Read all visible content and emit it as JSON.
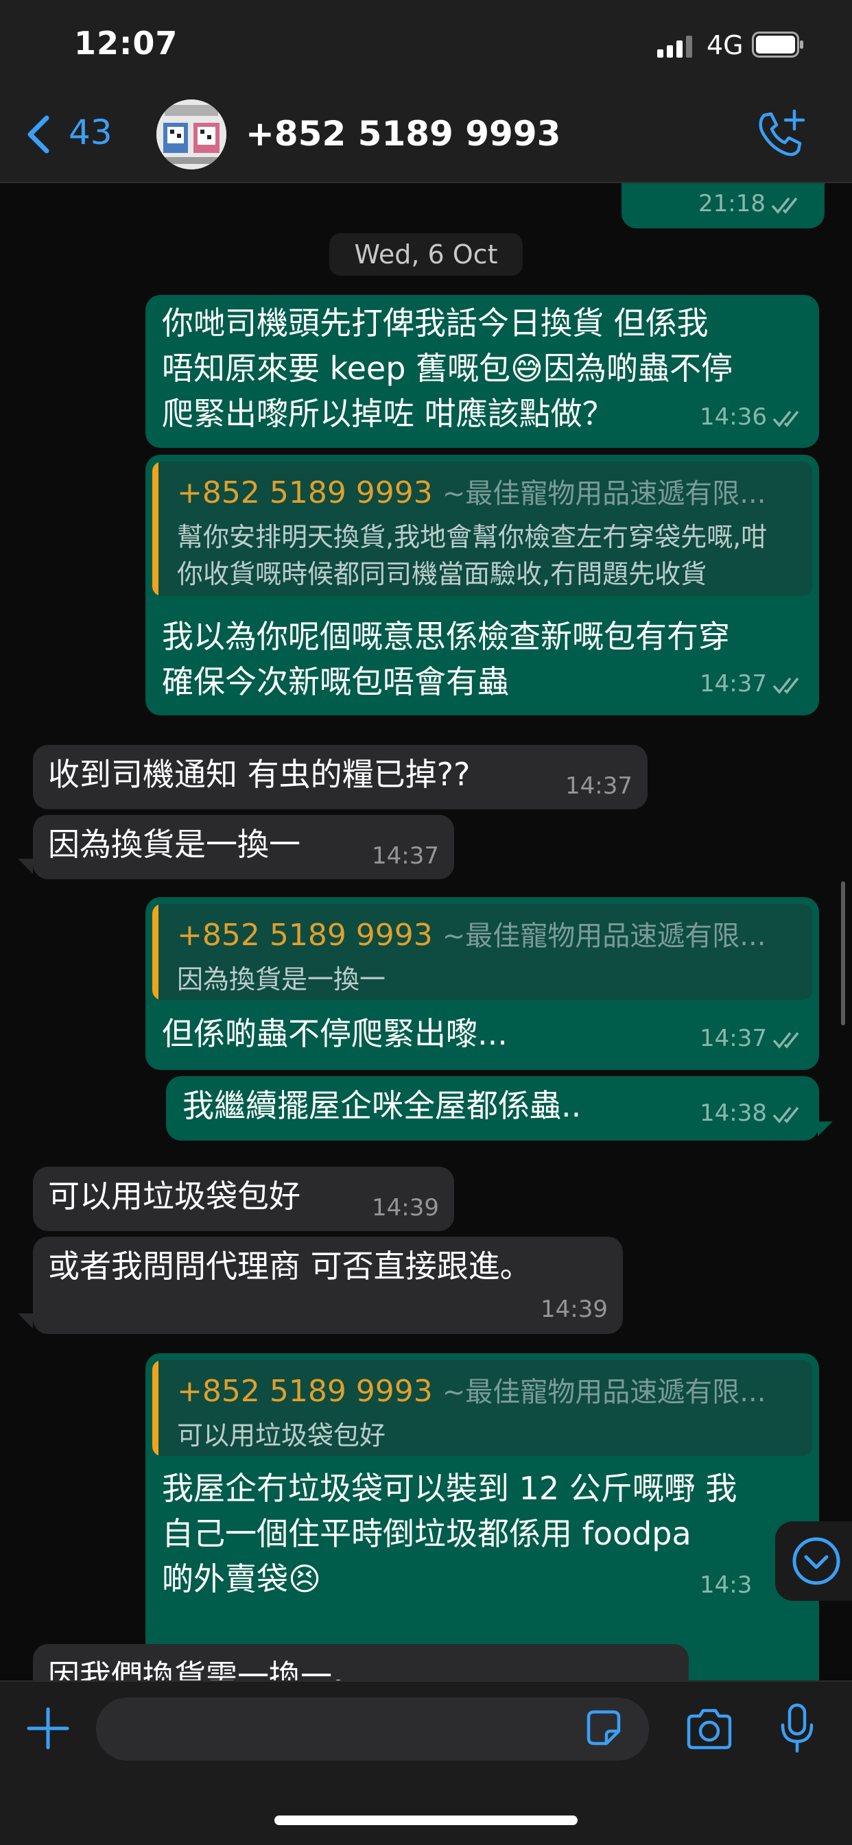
{
  "status_bar": {
    "time": "12:07",
    "network": "4G"
  },
  "header": {
    "back_count": "43",
    "contact_name": "+852 5189 9993"
  },
  "date_separator": "Wed, 6 Oct",
  "messages": [
    {
      "dir": "out",
      "time": "21:18",
      "partial": true
    },
    {
      "dir": "out",
      "lines": [
        "你哋司機頭先打俾我話今日換貨 但係我",
        "唔知原來要 keep 舊嘅包😅因為啲蟲不停",
        "爬緊出嚟所以掉咗 咁應該點做？"
      ],
      "time": "14:36"
    },
    {
      "dir": "out",
      "quote": {
        "number": "+852 5189 9993",
        "name": "~最佳寵物用品速遞有限...",
        "lines": [
          "幫你安排明天換貨,我地會幫你檢查左冇穿袋先嘅,咁",
          "你收貨嘅時候都同司機當面驗收,冇問題先收貨"
        ]
      },
      "lines": [
        "我以為你呢個嘅意思係檢查新嘅包有冇穿",
        "確保今次新嘅包唔會有蟲"
      ],
      "time": "14:37"
    },
    {
      "dir": "in",
      "lines": [
        "收到司機通知 有虫的糧已掉??"
      ],
      "time": "14:37"
    },
    {
      "dir": "in",
      "lines": [
        "因為換貨是一換一"
      ],
      "time": "14:37"
    },
    {
      "dir": "out",
      "quote": {
        "number": "+852 5189 9993",
        "name": "~最佳寵物用品速遞有限...",
        "lines": [
          "因為換貨是一換一"
        ]
      },
      "lines": [
        "但係啲蟲不停爬緊出嚟..."
      ],
      "time": "14:37"
    },
    {
      "dir": "out",
      "lines": [
        "我繼續擺屋企咪全屋都係蟲.."
      ],
      "time": "14:38"
    },
    {
      "dir": "in",
      "lines": [
        "可以用垃圾袋包好"
      ],
      "time": "14:39"
    },
    {
      "dir": "in",
      "lines": [
        "或者我問問代理商 可否直接跟進。"
      ],
      "time": "14:39"
    },
    {
      "dir": "out",
      "quote": {
        "number": "+852 5189 9993",
        "name": "~最佳寵物用品速遞有限...",
        "lines": [
          "可以用垃圾袋包好"
        ]
      },
      "lines": [
        "我屋企冇垃圾袋可以裝到 12 公斤嘅嘢 我",
        "自己一個住平時倒垃圾都係用 foodpa",
        "啲外賣袋😣"
      ],
      "time": "14:3"
    },
    {
      "dir": "in",
      "lines": [
        "因我們換貨需一換一。"
      ],
      "partial": true
    }
  ],
  "input": {
    "placeholder": ""
  },
  "colors": {
    "accent": "#3b9ff5",
    "outgoing_bubble": "#005c4b",
    "incoming_bubble": "#2a2a2c",
    "quote_name": "#e0a02c"
  },
  "icons": [
    "back-chevron-icon",
    "call-add-icon",
    "plus-icon",
    "sticker-icon",
    "camera-icon",
    "mic-icon",
    "chevron-down-icon"
  ]
}
